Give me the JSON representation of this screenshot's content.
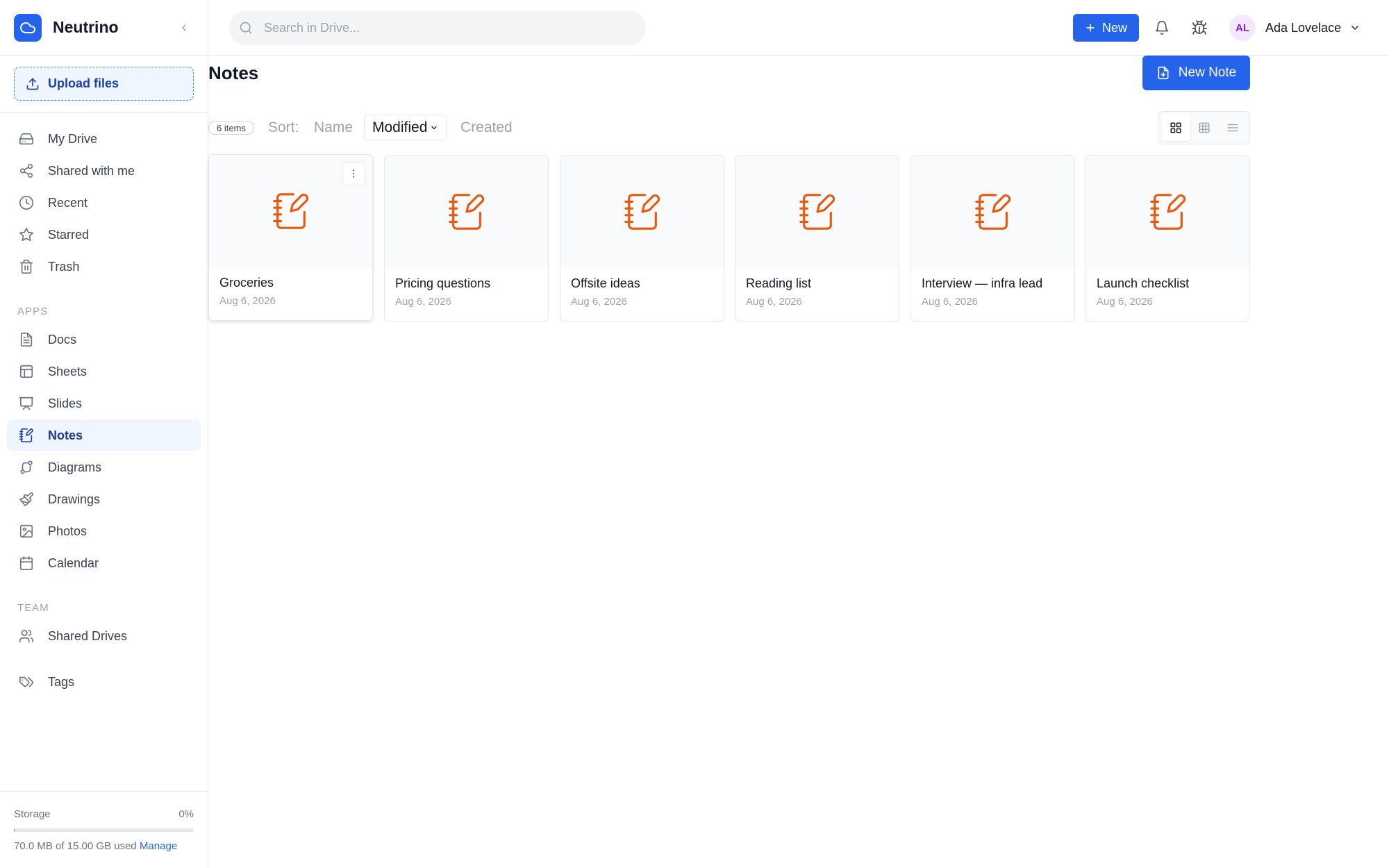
{
  "app": {
    "name": "Neutrino"
  },
  "sidebar": {
    "upload_label": "Upload files",
    "items": [
      {
        "label": "My Drive",
        "icon": "hard-drive-icon"
      },
      {
        "label": "Shared with me",
        "icon": "share-icon"
      },
      {
        "label": "Recent",
        "icon": "clock-icon"
      },
      {
        "label": "Starred",
        "icon": "star-icon"
      },
      {
        "label": "Trash",
        "icon": "trash-icon"
      }
    ],
    "apps_label": "APPS",
    "apps": [
      {
        "label": "Docs",
        "icon": "document-icon"
      },
      {
        "label": "Sheets",
        "icon": "table-icon"
      },
      {
        "label": "Slides",
        "icon": "presentation-icon"
      },
      {
        "label": "Notes",
        "icon": "notebook-icon",
        "active": true
      },
      {
        "label": "Diagrams",
        "icon": "diagram-icon"
      },
      {
        "label": "Drawings",
        "icon": "brush-icon"
      },
      {
        "label": "Photos",
        "icon": "image-icon"
      },
      {
        "label": "Calendar",
        "icon": "calendar-icon"
      }
    ],
    "team_label": "TEAM",
    "team": [
      {
        "label": "Shared Drives",
        "icon": "users-icon"
      }
    ],
    "tags_label": "Tags",
    "storage": {
      "label": "Storage",
      "percent_text": "0%",
      "percent": 0.5,
      "used_text": "70.0 MB of 15.00 GB used",
      "manage_label": "Manage"
    }
  },
  "topbar": {
    "search_placeholder": "Search in Drive...",
    "new_label": "New",
    "user": {
      "initials": "AL",
      "name": "Ada Lovelace"
    }
  },
  "main": {
    "title": "Notes",
    "new_note_label": "New Note",
    "count_text": "6 items",
    "sort": {
      "label": "Sort:",
      "options": [
        "Name",
        "Modified",
        "Created"
      ],
      "active": "Modified"
    },
    "view_mode": "grid",
    "notes": [
      {
        "title": "Groceries",
        "date": "Aug 6, 2026"
      },
      {
        "title": "Pricing questions",
        "date": "Aug 6, 2026"
      },
      {
        "title": "Offsite ideas",
        "date": "Aug 6, 2026"
      },
      {
        "title": "Reading list",
        "date": "Aug 6, 2026"
      },
      {
        "title": "Interview — infra lead",
        "date": "Aug 6, 2026"
      },
      {
        "title": "Launch checklist",
        "date": "Aug 6, 2026"
      }
    ]
  },
  "colors": {
    "accent": "#2563eb",
    "note_icon": "#ea580c",
    "active_nav_bg": "#eff6ff"
  }
}
